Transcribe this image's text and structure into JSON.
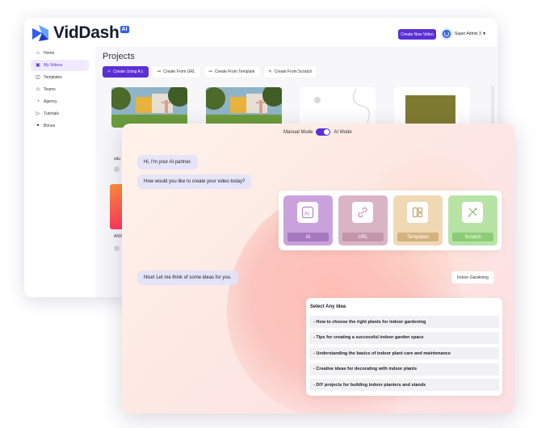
{
  "app": {
    "logo_text": "VidDash",
    "logo_badge": "AI"
  },
  "header": {
    "new_video_label": "Create New Video",
    "admin_name": "Super Admin 3 ▼"
  },
  "sidebar": {
    "items": [
      {
        "label": "Home",
        "icon": "home-icon"
      },
      {
        "label": "My Videos",
        "icon": "videos-icon",
        "active": true
      },
      {
        "label": "Templates",
        "icon": "templates-icon"
      },
      {
        "label": "Teams",
        "icon": "teams-icon"
      },
      {
        "label": "Agency",
        "icon": "agency-icon"
      },
      {
        "label": "Tutorials",
        "icon": "tutorials-icon"
      },
      {
        "label": "Bonus",
        "icon": "bonus-icon"
      }
    ]
  },
  "main": {
    "title": "Projects",
    "chips": [
      {
        "label": "Create Using A.I.",
        "icon": "sparkle-icon"
      },
      {
        "label": "Create From URL",
        "icon": "link-icon"
      },
      {
        "label": "Create From Template",
        "icon": "template-icon"
      },
      {
        "label": "Create From Scratch",
        "icon": "scratch-icon"
      }
    ],
    "card_labels": [
      "sdu",
      "ANX"
    ]
  },
  "chat": {
    "mode_manual": "Manual Mode",
    "mode_ai": "AI Mode",
    "greeting": "Hi, I'm your AI partner.",
    "question": "How would you like to create your video today?",
    "options": [
      {
        "label": "AI",
        "icon": "ai-icon"
      },
      {
        "label": "URL",
        "icon": "link-icon"
      },
      {
        "label": "Templates",
        "icon": "templates-icon"
      },
      {
        "label": "Scratch",
        "icon": "scratch-icon"
      }
    ],
    "thinking": "Nice! Let me think of some ideas for you.",
    "user_reply": "Indoor Gardening",
    "ideas_title": "Select Any Idea",
    "ideas": [
      "- How to choose the right plants for indoor gardening",
      "- Tips for creating a successful indoor garden space",
      "- Understanding the basics of indoor plant care and maintenance",
      "- Creative ideas for decorating with indoor plants",
      "- DIY projects for building indoor planters and stands"
    ]
  },
  "colors": {
    "accent": "#5b2fd6",
    "option_ai": "#c9a2dd",
    "option_url": "#d9b4c4",
    "option_templates": "#f0d8b4",
    "option_scratch": "#b7e3a4"
  }
}
